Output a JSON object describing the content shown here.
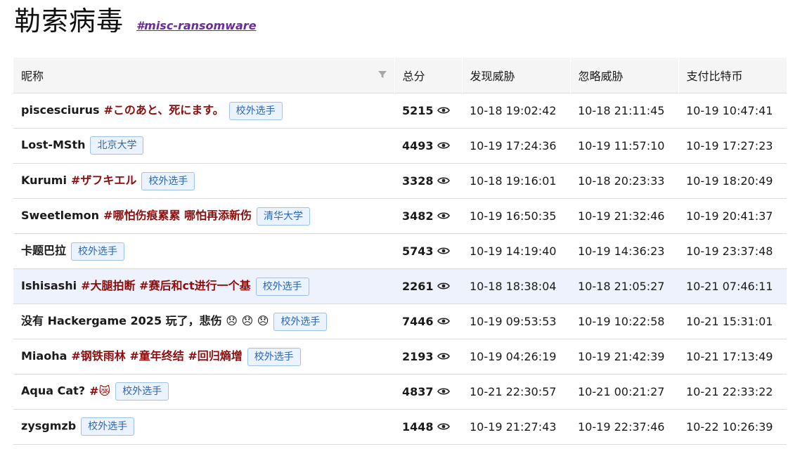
{
  "page": {
    "title": "勒索病毒",
    "tag": "#misc-ransomware"
  },
  "table": {
    "columns": [
      "昵称",
      "总分",
      "发现威胁",
      "忽略威胁",
      "支付比特币"
    ],
    "rows": [
      {
        "name": "piscesciurus",
        "motto": "#このあと、死にます。",
        "badge": "校外选手",
        "score": "5215",
        "found": "10-18 19:02:42",
        "ignored": "10-18 21:11:45",
        "paid": "10-19 10:47:41"
      },
      {
        "name": "Lost-MSth",
        "motto": "",
        "badge": "北京大学",
        "score": "4493",
        "found": "10-19 17:24:36",
        "ignored": "10-19 11:57:10",
        "paid": "10-19 17:27:23"
      },
      {
        "name": "Kurumi",
        "motto": "#ザフキエル",
        "badge": "校外选手",
        "score": "3328",
        "found": "10-18 19:16:01",
        "ignored": "10-18 20:23:33",
        "paid": "10-19 18:20:49"
      },
      {
        "name": "Sweetlemon",
        "motto": "#哪怕伤痕累累 哪怕再添新伤",
        "badge": "清华大学",
        "score": "3482",
        "found": "10-19 16:50:35",
        "ignored": "10-19 21:32:46",
        "paid": "10-19 20:41:37"
      },
      {
        "name": "卡题巴拉",
        "motto": "",
        "badge": "校外选手",
        "score": "5743",
        "found": "10-19 14:19:40",
        "ignored": "10-19 14:36:23",
        "paid": "10-19 23:37:48"
      },
      {
        "name": "Ishisashi",
        "motto": "#大腿拍断 #赛后和ct进行一个基",
        "badge": "校外选手",
        "score": "2261",
        "found": "10-18 18:38:04",
        "ignored": "10-18 21:05:27",
        "paid": "10-21 07:46:11"
      },
      {
        "name": "没有 Hackergame 2025 玩了，悲伤 😞 😞 😞",
        "motto": "",
        "badge": "校外选手",
        "score": "7446",
        "found": "10-19 09:53:53",
        "ignored": "10-19 10:22:58",
        "paid": "10-21 15:31:01"
      },
      {
        "name": "Miaoha",
        "motto": "#钢铁雨林 #童年终结 #回归熵增",
        "badge": "校外选手",
        "score": "2193",
        "found": "10-19 04:26:19",
        "ignored": "10-19 21:42:39",
        "paid": "10-21 17:13:49"
      },
      {
        "name": "Aqua Cat?",
        "motto": "#😿",
        "badge": "校外选手",
        "score": "4837",
        "found": "10-21 22:30:57",
        "ignored": "10-21 00:21:27",
        "paid": "10-21 22:33:22"
      },
      {
        "name": "zysgmzb",
        "motto": "",
        "badge": "校外选手",
        "score": "1448",
        "found": "10-19 21:27:43",
        "ignored": "10-19 22:37:46",
        "paid": "10-22 10:26:39"
      }
    ]
  },
  "icons": {
    "filter": "filter-icon",
    "score_view": "eye-icon"
  },
  "colors": {
    "motto": "#8b0d0d",
    "badge_text": "#2f66b3",
    "badge_bg": "#eaf3ff",
    "tag_link": "#6a2c9a",
    "highlight_row": "#eef2fc"
  }
}
